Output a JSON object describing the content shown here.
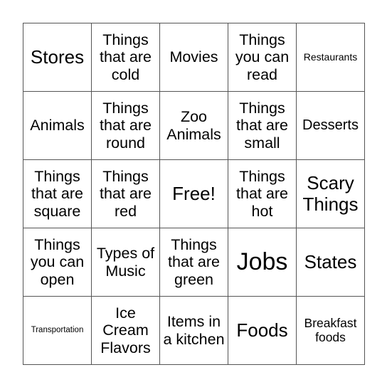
{
  "card": {
    "rows": [
      [
        {
          "text": "Stores",
          "size": "s-l"
        },
        {
          "text": "Things that are cold",
          "size": "s-m"
        },
        {
          "text": "Movies",
          "size": "s-m"
        },
        {
          "text": "Things you can read",
          "size": "s-m"
        },
        {
          "text": "Restaurants",
          "size": "s-xs"
        }
      ],
      [
        {
          "text": "Animals",
          "size": "s-m"
        },
        {
          "text": "Things that are round",
          "size": "s-m"
        },
        {
          "text": "Zoo Animals",
          "size": "s-m"
        },
        {
          "text": "Things that are small",
          "size": "s-m"
        },
        {
          "text": "Desserts",
          "size": "s-ms"
        }
      ],
      [
        {
          "text": "Things that are square",
          "size": "s-m"
        },
        {
          "text": "Things that are red",
          "size": "s-m"
        },
        {
          "text": "Free!",
          "size": "s-l"
        },
        {
          "text": "Things that are hot",
          "size": "s-m"
        },
        {
          "text": "Scary Things",
          "size": "s-l"
        }
      ],
      [
        {
          "text": "Things you can open",
          "size": "s-m"
        },
        {
          "text": "Types of Music",
          "size": "s-m"
        },
        {
          "text": "Things that are green",
          "size": "s-m"
        },
        {
          "text": "Jobs",
          "size": "s-xl"
        },
        {
          "text": "States",
          "size": "s-l"
        }
      ],
      [
        {
          "text": "Transportation",
          "size": "s-xxs"
        },
        {
          "text": "Ice Cream Flavors",
          "size": "s-m"
        },
        {
          "text": "Items in a kitchen",
          "size": "s-m"
        },
        {
          "text": "Foods",
          "size": "s-l"
        },
        {
          "text": "Breakfast foods",
          "size": "s-s"
        }
      ]
    ]
  }
}
